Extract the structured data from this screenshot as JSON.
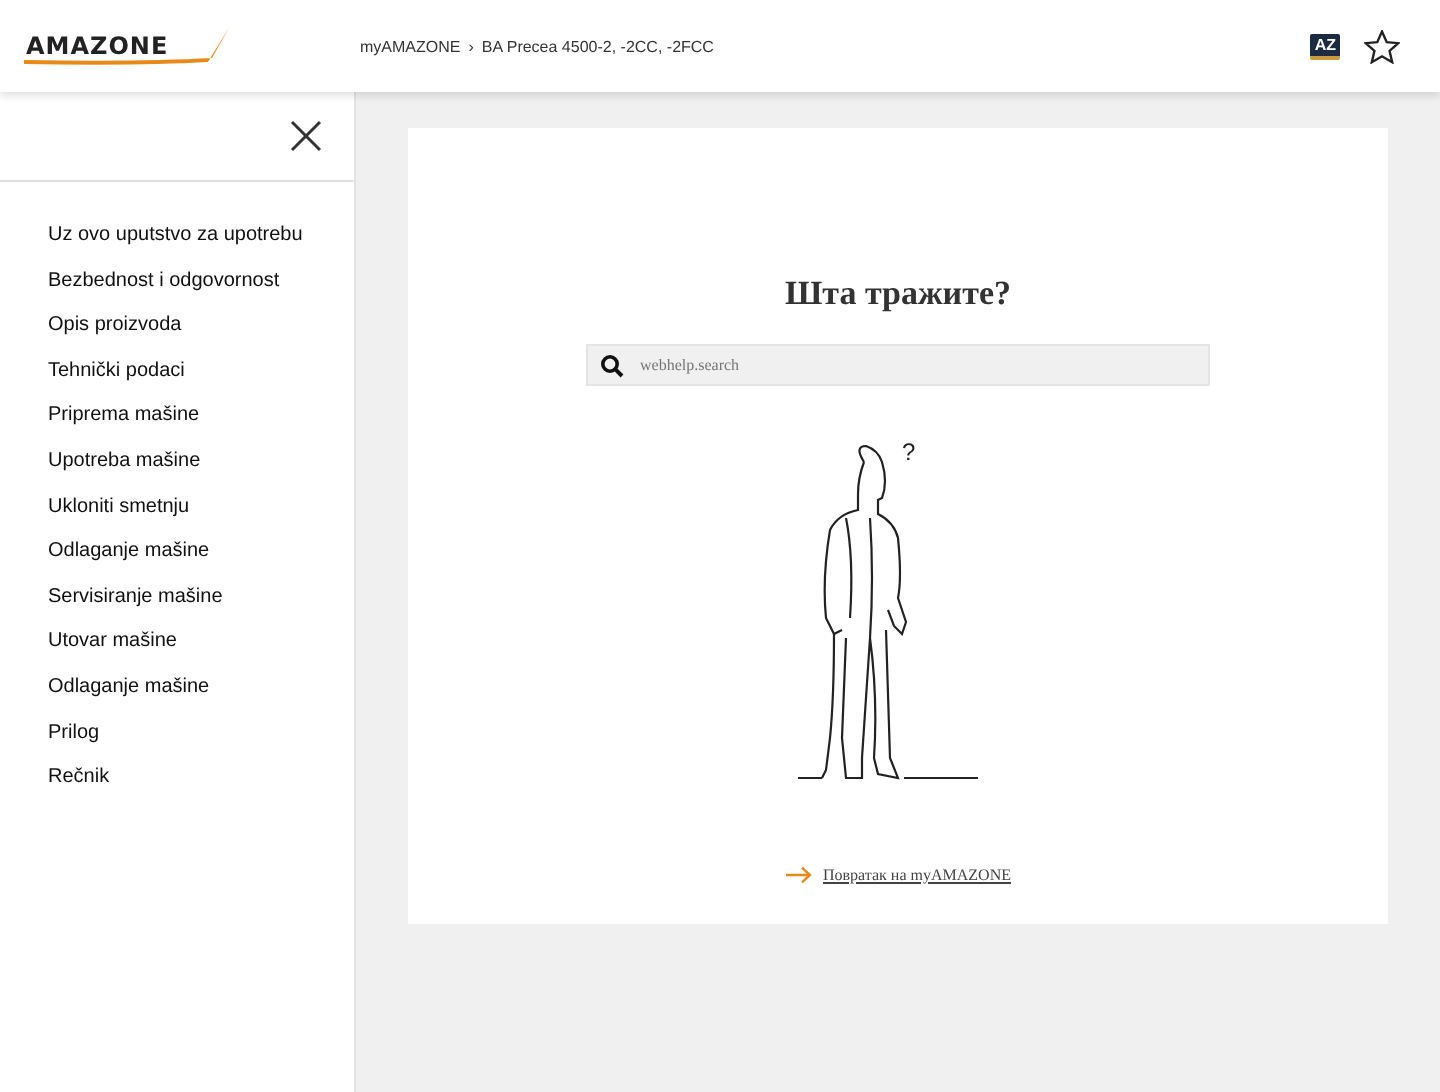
{
  "header": {
    "logo": "AMAZONE",
    "breadcrumb": [
      "myAMAZONE",
      "BA Precea 4500-2, -2CC, -2FCC"
    ],
    "breadcrumb_separator": "›",
    "glossary_button": "AZ"
  },
  "sidebar": {
    "items": [
      {
        "label": "Uz ovo uputstvo za upotrebu"
      },
      {
        "label": "Bezbednost i odgovornost"
      },
      {
        "label": "Opis proizvoda"
      },
      {
        "label": "Tehnički podaci"
      },
      {
        "label": "Priprema mašine"
      },
      {
        "label": "Upotreba mašine"
      },
      {
        "label": "Ukloniti smetnju"
      },
      {
        "label": "Odlaganje mašine"
      },
      {
        "label": "Servisiranje mašine"
      },
      {
        "label": "Utovar mašine"
      },
      {
        "label": "Odlaganje mašine"
      },
      {
        "label": "Prilog"
      },
      {
        "label": "Rečnik"
      }
    ]
  },
  "main": {
    "title": "Шта тражите?",
    "search": {
      "placeholder": "webhelp.search"
    },
    "illustration_mark": "?",
    "back_link": "Повратак на myAMAZONE"
  }
}
